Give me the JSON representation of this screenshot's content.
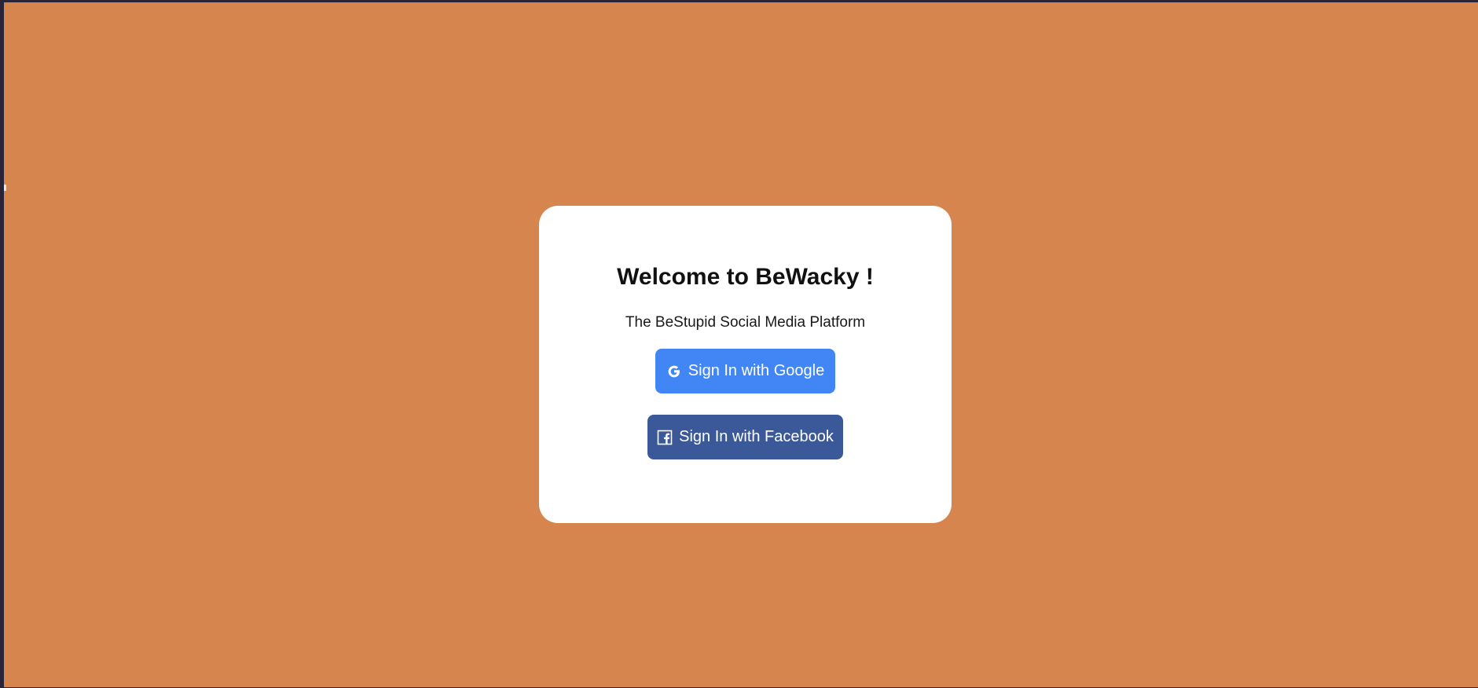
{
  "page": {
    "background_color": "#d6854f"
  },
  "login_card": {
    "title": "Welcome to BeWacky !",
    "subtitle": "The BeStupid Social Media Platform",
    "google_button": {
      "label": "Sign In with Google",
      "icon": "google-icon",
      "color": "#4285f4"
    },
    "facebook_button": {
      "label": "Sign In with Facebook",
      "icon": "facebook-icon",
      "color": "#3b5998"
    }
  }
}
